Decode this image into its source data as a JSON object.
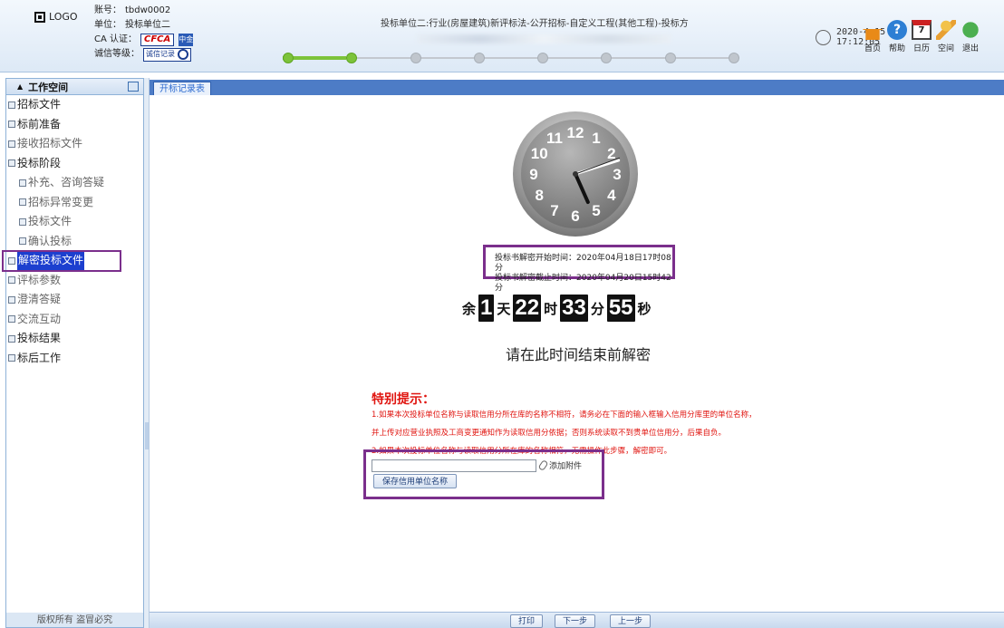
{
  "header": {
    "logo": "LOGO",
    "account_label": "账号：",
    "account": "tbdw0002",
    "unit_label": "单位：",
    "unit": "投标单位二",
    "ca_label": "CA 认证：",
    "ca_badge": "CFCA",
    "ca_seal": "中金",
    "credit_label": "诚信等级：",
    "credit_badge": "诚信记录",
    "project_title": "投标单位二:行业(房屋建筑)新评标法-公开招标-自定义工程(其他工程)-投标方",
    "progress_done_steps": 2,
    "progress_total_steps": 8,
    "date": "2020-4-15",
    "time": "17:12:05",
    "tools": [
      "首页",
      "帮助",
      "日历",
      "空间",
      "退出"
    ],
    "tool_icons": [
      "home-icon",
      "help-icon",
      "calendar-icon",
      "space-icon",
      "exit-icon"
    ],
    "calendar_day": "7",
    "help_glyph": "?"
  },
  "sidebar": {
    "title": "工作空间",
    "items": [
      {
        "label": "招标文件",
        "level": 0,
        "style": "normal"
      },
      {
        "label": "标前准备",
        "level": 0,
        "style": "normal"
      },
      {
        "label": "接收招标文件",
        "level": 0,
        "style": "grey"
      },
      {
        "label": "投标阶段",
        "level": 0,
        "style": "normal"
      },
      {
        "label": "补充、咨询答疑",
        "level": 1,
        "style": "grey"
      },
      {
        "label": "招标异常变更",
        "level": 1,
        "style": "grey"
      },
      {
        "label": "投标文件",
        "level": 1,
        "style": "grey"
      },
      {
        "label": "确认投标",
        "level": 1,
        "style": "grey"
      },
      {
        "label": "解密投标文件",
        "level": 0,
        "style": "selected"
      },
      {
        "label": "评标参数",
        "level": 0,
        "style": "grey"
      },
      {
        "label": "澄清答疑",
        "level": 0,
        "style": "grey"
      },
      {
        "label": "交流互动",
        "level": 0,
        "style": "grey"
      },
      {
        "label": "投标结果",
        "level": 0,
        "style": "normal"
      },
      {
        "label": "标后工作",
        "level": 0,
        "style": "normal"
      }
    ],
    "footer": "版权所有 盗冒必究"
  },
  "tab": {
    "label": "开标记录表"
  },
  "clock": {
    "hour": 5,
    "minute": 12,
    "second": 5,
    "numbers": [
      "12",
      "1",
      "2",
      "3",
      "4",
      "5",
      "6",
      "7",
      "8",
      "9",
      "10",
      "11"
    ]
  },
  "decrypt": {
    "start_label": "投标书解密开始时间：",
    "start_value": "2020年04月18日17时08分",
    "end_label": "投标书解密截止时间：",
    "end_value": "2020年04月20日15时42分"
  },
  "countdown": {
    "prefix": "余",
    "days": "1",
    "days_unit": "天",
    "hours": "22",
    "hours_unit": "时",
    "minutes": "33",
    "minutes_unit": "分",
    "seconds": "55",
    "seconds_unit": "秒"
  },
  "prompt": "请在此时间结束前解密",
  "notice": {
    "title": "特别提示：",
    "line1": "1.如果本次投标单位名称与读取信用分所在库的名称不相符，请务必在下面的输入框输入信用分库里的单位名称，",
    "line2": "并上传对应营业执照及工商变更通知作为读取信用分依据；否则系统读取不到贵单位信用分，后果自负。",
    "line3": "2.如果本次投标单位名称与读取信用分所在库的名称相符，无需操作此步骤，解密即可。"
  },
  "form": {
    "input_value": "",
    "input_placeholder": "",
    "attach_label": "添加附件",
    "save_label": "保存信用单位名称"
  },
  "bottom": {
    "print": "打印",
    "next": "下一步",
    "prev": "上一步"
  }
}
